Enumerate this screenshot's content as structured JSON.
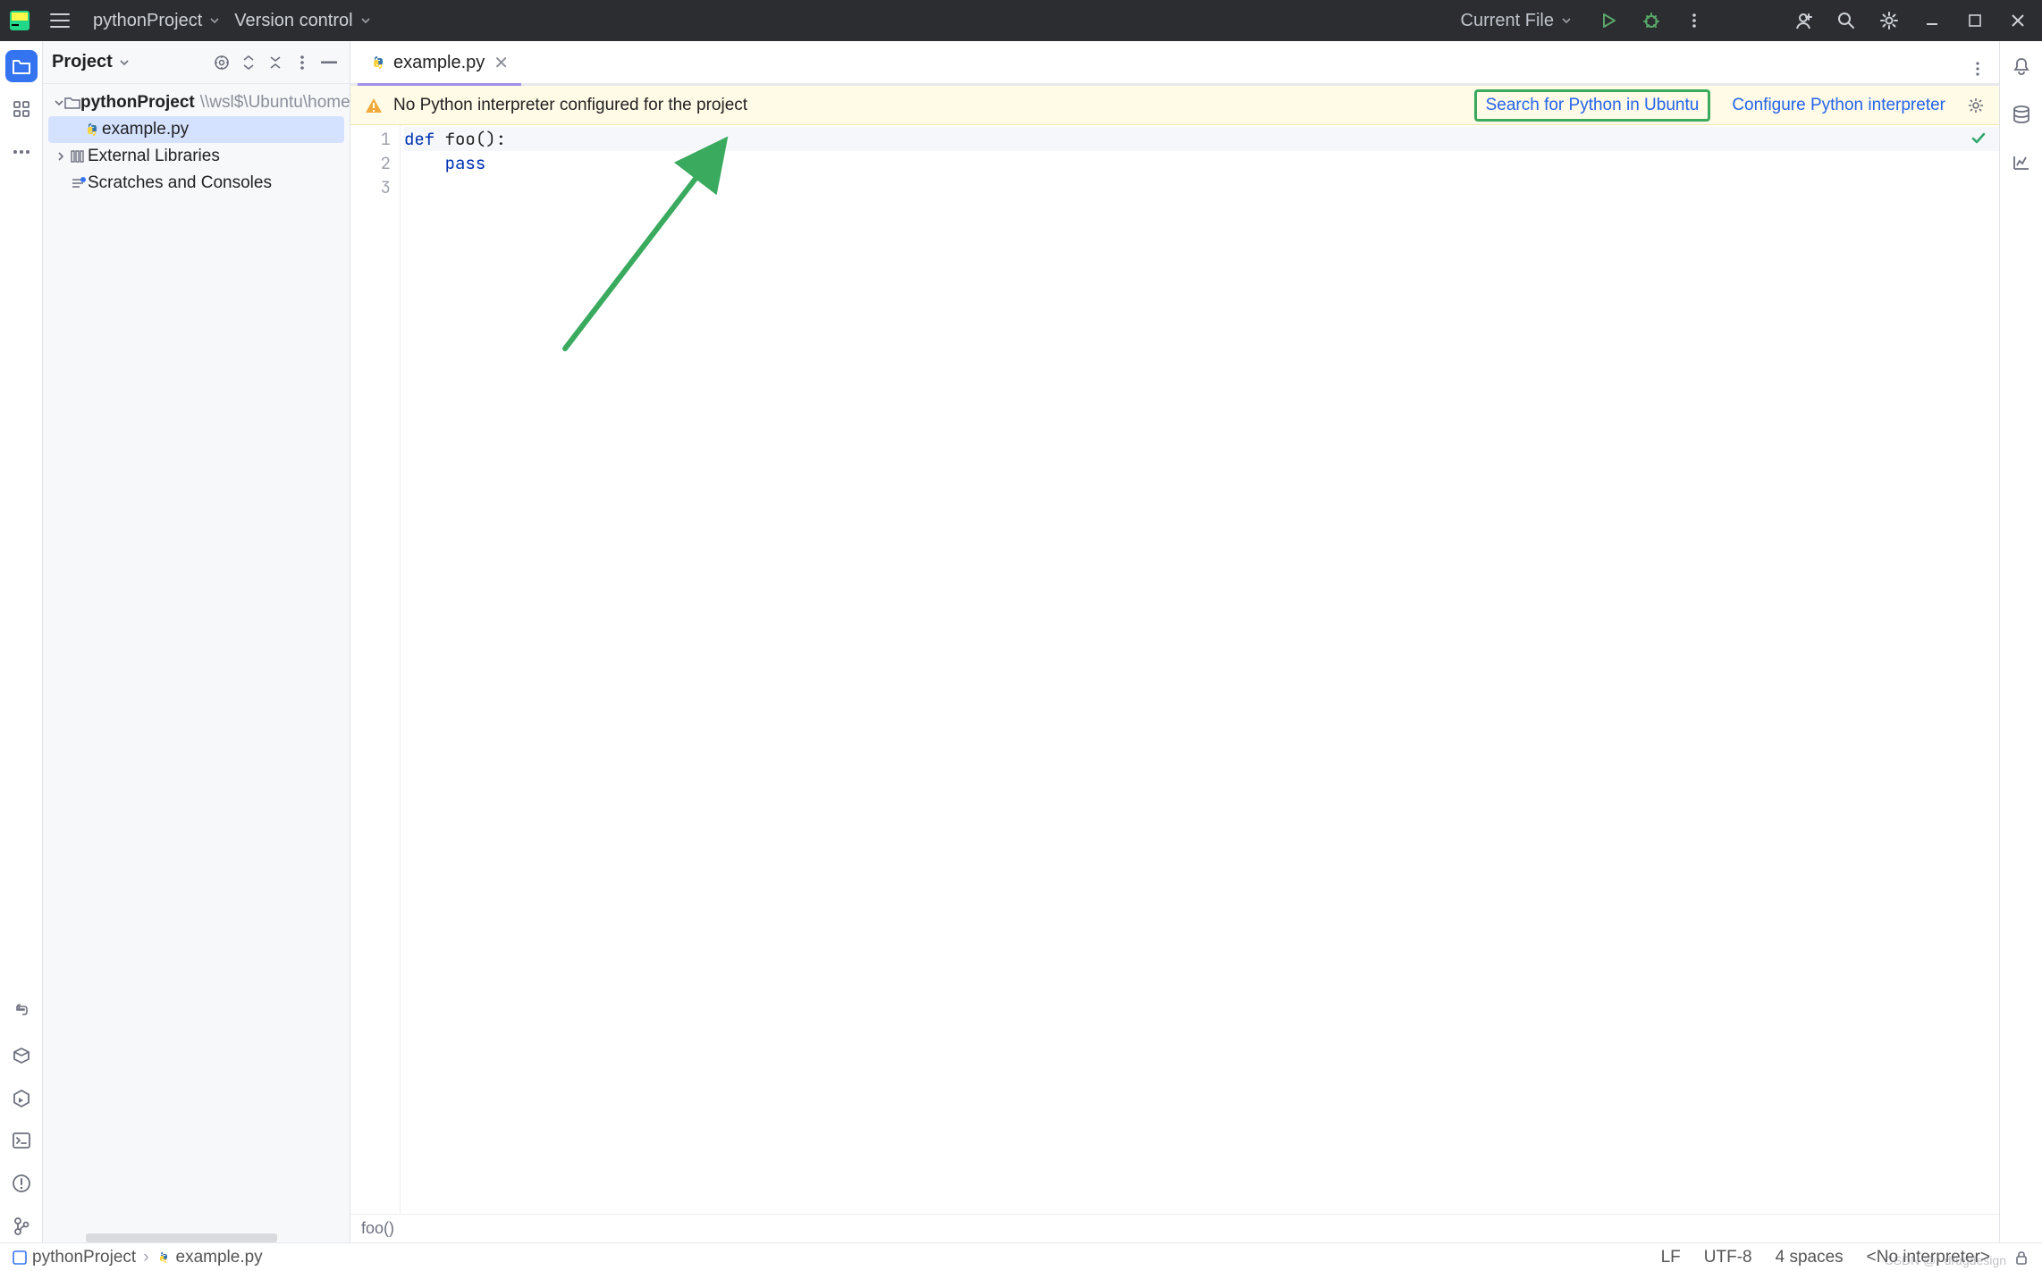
{
  "titlebar": {
    "project_crumb": "pythonProject",
    "vcs_crumb": "Version control",
    "run_config": "Current File"
  },
  "project_panel": {
    "title": "Project",
    "root": {
      "name": "pythonProject",
      "path": "\\\\wsl$\\Ubuntu\\home\\"
    },
    "file": "example.py",
    "external": "External Libraries",
    "scratches": "Scratches and Consoles"
  },
  "editor": {
    "tab": "example.py",
    "lines": [
      "1",
      "2",
      "3"
    ],
    "code": {
      "l1_kw": "def ",
      "l1_fn": "foo",
      "l1_rest": "():",
      "l2_indent": "    ",
      "l2_kw": "pass",
      "l3": ""
    },
    "status_crumb": "foo()"
  },
  "banner": {
    "message": "No Python interpreter configured for the project",
    "link_search": "Search for Python in Ubuntu",
    "link_configure": "Configure Python interpreter"
  },
  "statusbar": {
    "crumb1": "pythonProject",
    "crumb2": "example.py",
    "lf": "LF",
    "encoding": "UTF-8",
    "indent": "4 spaces",
    "interpreter": "<No interpreter>"
  },
  "watermark": "CSDN @* drugdesign"
}
